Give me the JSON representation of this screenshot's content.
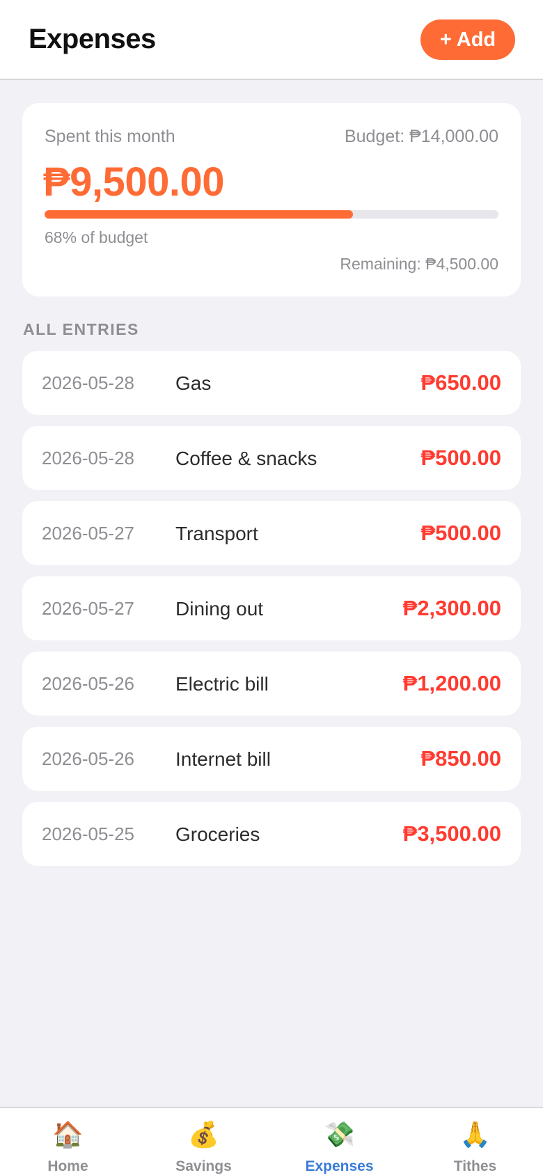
{
  "header": {
    "title": "Expenses",
    "add_label": "+ Add"
  },
  "summary": {
    "spent_label": "Spent this month",
    "budget_label": "Budget: ₱14,000.00",
    "spent_amount": "₱9,500.00",
    "progress_percent": 68,
    "percent_label": "68% of budget",
    "remaining_label": "Remaining: ₱4,500.00"
  },
  "entries_section": {
    "title": "ALL ENTRIES",
    "items": [
      {
        "date": "2026-05-28",
        "description": "Gas",
        "amount": "₱650.00"
      },
      {
        "date": "2026-05-28",
        "description": "Coffee & snacks",
        "amount": "₱500.00"
      },
      {
        "date": "2026-05-27",
        "description": "Transport",
        "amount": "₱500.00"
      },
      {
        "date": "2026-05-27",
        "description": "Dining out",
        "amount": "₱2,300.00"
      },
      {
        "date": "2026-05-26",
        "description": "Electric bill",
        "amount": "₱1,200.00"
      },
      {
        "date": "2026-05-26",
        "description": "Internet bill",
        "amount": "₱850.00"
      },
      {
        "date": "2026-05-25",
        "description": "Groceries",
        "amount": "₱3,500.00"
      }
    ]
  },
  "nav": {
    "items": [
      {
        "label": "Home",
        "icon": "🏠",
        "icon_name": "house-icon"
      },
      {
        "label": "Savings",
        "icon": "💰",
        "icon_name": "money-bag-icon"
      },
      {
        "label": "Expenses",
        "icon": "💸",
        "icon_name": "money-with-wings-icon",
        "active": true
      },
      {
        "label": "Tithes",
        "icon": "🙏",
        "icon_name": "praying-hands-icon"
      }
    ]
  },
  "colors": {
    "accent": "#ff6b35",
    "expense_amount": "#ff3b30",
    "nav_active": "#3b7bd8",
    "background": "#f1f1f6"
  }
}
